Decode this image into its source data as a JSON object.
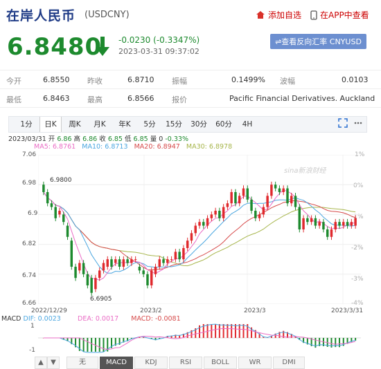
{
  "header": {
    "title": "在岸人民币",
    "code": "(USDCNY)",
    "add_label": "添加自选",
    "app_label": "在APP中查看"
  },
  "quote": {
    "price": "6.8480",
    "change": "-0.0230 (-0.3347%)",
    "time": "2023-03-31 09:37:02",
    "reverse_label": "⇌查看反向汇率 CNYUSD"
  },
  "stats": {
    "row1": [
      {
        "label": "今开",
        "value": "6.8550"
      },
      {
        "label": "昨收",
        "value": "6.8710"
      },
      {
        "label": "振幅",
        "value": "0.1499%"
      },
      {
        "label": "波幅",
        "value": "0.0103"
      }
    ],
    "row2": [
      {
        "label": "最低",
        "value": "6.8463"
      },
      {
        "label": "最高",
        "value": "6.8566"
      },
      {
        "label": "报价",
        "value": "Pacific Financial Derivatives. Auckland"
      }
    ]
  },
  "tabs": [
    "1分",
    "日K",
    "周K",
    "月K",
    "年K",
    "5分",
    "15分",
    "30分",
    "60分",
    "4H"
  ],
  "active_tab": "日K",
  "chart_info": {
    "date": "2023/03/31",
    "open_label": "开",
    "open": "6.86",
    "high_label": "高",
    "high": "6.86",
    "close_label": "收",
    "close": "6.85",
    "low_label": "低",
    "low": "6.85",
    "vol_label": "量",
    "vol": "0",
    "pct": "-0.33%"
  },
  "ma": {
    "ma5": "MA5: 6.8761",
    "ma10": "MA10: 6.8713",
    "ma20": "MA20: 6.8947",
    "ma30": "MA30: 6.8978"
  },
  "colors": {
    "up": "#e0292d",
    "down": "#1d8a2e",
    "ma5": "#ea6cc5",
    "ma10": "#4aa6e0",
    "ma20": "#d64a4a",
    "ma30": "#a6b54a"
  },
  "watermark": "sina新浪财经",
  "chart_data": {
    "type": "candlestick",
    "y_ticks": [
      "7.06",
      "6.98",
      "6.9",
      "6.82",
      "6.74",
      "6.66"
    ],
    "y_pct_ticks": [
      "1%",
      "0%",
      "-1%",
      "-2%",
      "-3%",
      "-4%"
    ],
    "x_ticks": [
      "2022/12/29",
      "2023/2",
      "2023/3",
      "2023/3/31"
    ],
    "annotations": {
      "max": "6.9800",
      "min": "6.6905"
    },
    "ylim": [
      6.66,
      7.06
    ],
    "candles": [
      [
        6.98,
        6.96
      ],
      [
        6.96,
        6.93
      ],
      [
        6.93,
        6.92
      ],
      [
        6.92,
        6.89
      ],
      [
        6.9,
        6.91
      ],
      [
        6.9,
        6.88
      ],
      [
        6.87,
        6.84
      ],
      [
        6.83,
        6.76
      ],
      [
        6.76,
        6.73
      ],
      [
        6.75,
        6.77
      ],
      [
        6.77,
        6.74
      ],
      [
        6.74,
        6.71
      ],
      [
        6.73,
        6.69
      ],
      [
        6.7,
        6.73
      ],
      [
        6.73,
        6.75
      ],
      [
        6.75,
        6.77
      ],
      [
        6.76,
        6.78
      ],
      [
        6.78,
        6.76
      ],
      [
        6.77,
        6.78
      ],
      [
        6.78,
        6.76
      ],
      [
        6.76,
        6.78
      ],
      [
        6.78,
        6.77
      ],
      [
        6.77,
        6.78
      ],
      [
        6.78,
        6.78
      ],
      [
        6.76,
        6.75
      ],
      [
        6.75,
        6.74
      ],
      [
        6.74,
        6.71
      ],
      [
        6.71,
        6.75
      ],
      [
        6.74,
        6.76
      ],
      [
        6.76,
        6.78
      ],
      [
        6.78,
        6.77
      ],
      [
        6.77,
        6.78
      ],
      [
        6.78,
        6.78
      ],
      [
        6.78,
        6.8
      ],
      [
        6.8,
        6.78
      ],
      [
        6.78,
        6.81
      ],
      [
        6.81,
        6.83
      ],
      [
        6.83,
        6.85
      ],
      [
        6.85,
        6.87
      ],
      [
        6.87,
        6.88
      ],
      [
        6.88,
        6.87
      ],
      [
        6.87,
        6.89
      ],
      [
        6.89,
        6.9
      ],
      [
        6.9,
        6.91
      ],
      [
        6.91,
        6.89
      ],
      [
        6.89,
        6.92
      ],
      [
        6.92,
        6.93
      ],
      [
        6.93,
        6.96
      ],
      [
        6.96,
        6.93
      ],
      [
        6.93,
        6.95
      ],
      [
        6.95,
        6.97
      ],
      [
        6.97,
        6.94
      ],
      [
        6.94,
        6.91
      ],
      [
        6.91,
        6.89
      ],
      [
        6.89,
        6.9
      ],
      [
        6.9,
        6.92
      ],
      [
        6.92,
        6.95
      ],
      [
        6.95,
        6.98
      ],
      [
        6.98,
        6.97
      ],
      [
        6.97,
        6.96
      ],
      [
        6.96,
        6.97
      ],
      [
        6.97,
        6.93
      ],
      [
        6.93,
        6.95
      ],
      [
        6.95,
        6.92
      ],
      [
        6.92,
        6.86
      ],
      [
        6.86,
        6.89
      ],
      [
        6.89,
        6.88
      ],
      [
        6.88,
        6.89
      ],
      [
        6.89,
        6.87
      ],
      [
        6.87,
        6.88
      ],
      [
        6.88,
        6.86
      ],
      [
        6.86,
        6.84
      ],
      [
        6.84,
        6.86
      ],
      [
        6.86,
        6.88
      ],
      [
        6.88,
        6.87
      ],
      [
        6.87,
        6.88
      ],
      [
        6.88,
        6.87
      ],
      [
        6.87,
        6.88
      ],
      [
        6.87,
        6.89
      ]
    ]
  },
  "macd": {
    "label": "MACD",
    "dif": "DIF: 0.0023",
    "dea": "DEA: 0.0017",
    "macd": "MACD: -0.0081",
    "y_top": "1",
    "y_bot": "-1"
  },
  "indicators": [
    "无",
    "MACD",
    "KDJ",
    "RSI",
    "BOLL",
    "WR",
    "DMI"
  ],
  "active_indicator": "MACD"
}
